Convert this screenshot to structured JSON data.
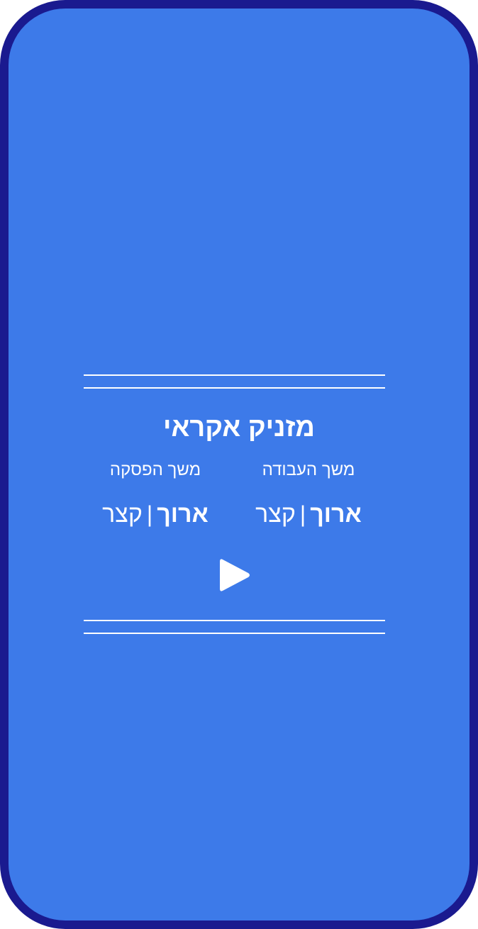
{
  "title": "מזניק אקראי",
  "work_duration": {
    "label": "משך העבודה",
    "options": [
      "ארוך",
      "קצר"
    ],
    "selected": "ארוך",
    "separator": "|"
  },
  "break_duration": {
    "label": "משך הפסקה",
    "options": [
      "ארוך",
      "קצר"
    ],
    "selected": "ארוך",
    "separator": "|"
  },
  "play_button": {
    "icon": "play-icon"
  },
  "colors": {
    "frame": "#1a1a8f",
    "background": "#3d7ae9",
    "foreground": "#ffffff"
  }
}
